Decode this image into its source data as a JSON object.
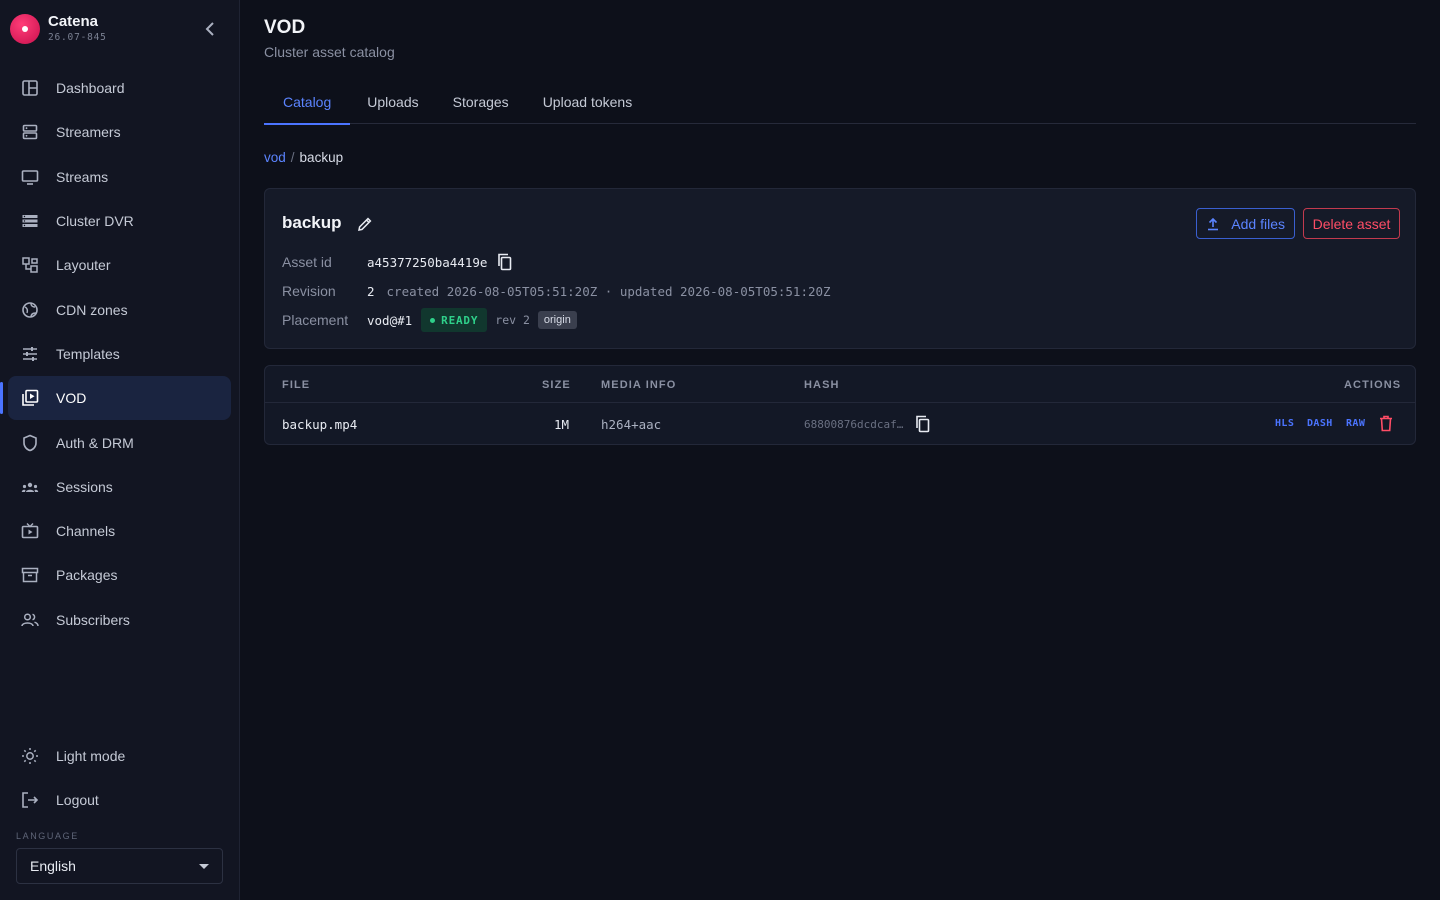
{
  "app": {
    "name": "Catena",
    "version": "26.07-845"
  },
  "nav": {
    "items": [
      {
        "label": "Dashboard",
        "icon": "dashboard-icon"
      },
      {
        "label": "Streamers",
        "icon": "server-icon"
      },
      {
        "label": "Streams",
        "icon": "monitor-icon"
      },
      {
        "label": "Cluster DVR",
        "icon": "storage-icon"
      },
      {
        "label": "Layouter",
        "icon": "layout-icon"
      },
      {
        "label": "CDN zones",
        "icon": "globe-icon"
      },
      {
        "label": "Templates",
        "icon": "sliders-icon"
      },
      {
        "label": "VOD",
        "icon": "video-library-icon",
        "active": true
      },
      {
        "label": "Auth & DRM",
        "icon": "shield-icon"
      },
      {
        "label": "Sessions",
        "icon": "groups-icon"
      },
      {
        "label": "Channels",
        "icon": "tv-icon"
      },
      {
        "label": "Packages",
        "icon": "archive-icon"
      },
      {
        "label": "Subscribers",
        "icon": "people-icon"
      }
    ],
    "light_mode": "Light mode",
    "logout": "Logout",
    "language_label": "LANGUAGE",
    "language": "English"
  },
  "page": {
    "title": "VOD",
    "subtitle": "Cluster asset catalog",
    "tabs": [
      "Catalog",
      "Uploads",
      "Storages",
      "Upload tokens"
    ],
    "active_tab": "Catalog"
  },
  "breadcrumb": {
    "root": "vod",
    "sep": "/",
    "current": "backup"
  },
  "asset": {
    "name": "backup",
    "add_files": "Add files",
    "delete": "Delete asset",
    "asset_id_label": "Asset id",
    "asset_id": "a45377250ba4419e",
    "revision_label": "Revision",
    "revision": "2",
    "revision_detail": "created 2026-08-05T05:51:20Z · updated 2026-08-05T05:51:20Z",
    "placement_label": "Placement",
    "placement": "vod@#1",
    "status": "READY",
    "rev": "rev 2",
    "origin": "origin"
  },
  "files": {
    "headers": {
      "file": "FILE",
      "size": "SIZE",
      "media": "MEDIA INFO",
      "hash": "HASH",
      "actions": "ACTIONS"
    },
    "rows": [
      {
        "file": "backup.mp4",
        "size": "1M",
        "media": "h264+aac",
        "hash": "68800876dcdcaf…",
        "hls": "HLS",
        "dash": "DASH",
        "raw": "RAW"
      }
    ]
  },
  "colors": {
    "accent": "#4b74ff",
    "danger": "#ff4d66",
    "success": "#2fd08a",
    "background": "#0d101a"
  }
}
